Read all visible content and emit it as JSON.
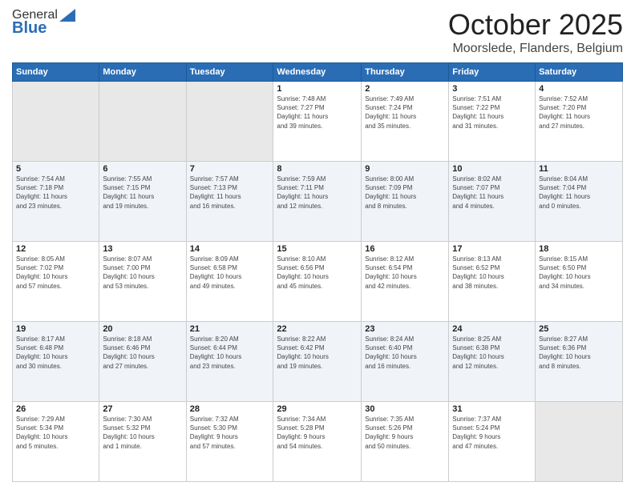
{
  "header": {
    "logo_general": "General",
    "logo_blue": "Blue",
    "month": "October 2025",
    "location": "Moorslede, Flanders, Belgium"
  },
  "weekdays": [
    "Sunday",
    "Monday",
    "Tuesday",
    "Wednesday",
    "Thursday",
    "Friday",
    "Saturday"
  ],
  "weeks": [
    [
      {
        "day": "",
        "info": ""
      },
      {
        "day": "",
        "info": ""
      },
      {
        "day": "",
        "info": ""
      },
      {
        "day": "1",
        "info": "Sunrise: 7:48 AM\nSunset: 7:27 PM\nDaylight: 11 hours\nand 39 minutes."
      },
      {
        "day": "2",
        "info": "Sunrise: 7:49 AM\nSunset: 7:24 PM\nDaylight: 11 hours\nand 35 minutes."
      },
      {
        "day": "3",
        "info": "Sunrise: 7:51 AM\nSunset: 7:22 PM\nDaylight: 11 hours\nand 31 minutes."
      },
      {
        "day": "4",
        "info": "Sunrise: 7:52 AM\nSunset: 7:20 PM\nDaylight: 11 hours\nand 27 minutes."
      }
    ],
    [
      {
        "day": "5",
        "info": "Sunrise: 7:54 AM\nSunset: 7:18 PM\nDaylight: 11 hours\nand 23 minutes."
      },
      {
        "day": "6",
        "info": "Sunrise: 7:55 AM\nSunset: 7:15 PM\nDaylight: 11 hours\nand 19 minutes."
      },
      {
        "day": "7",
        "info": "Sunrise: 7:57 AM\nSunset: 7:13 PM\nDaylight: 11 hours\nand 16 minutes."
      },
      {
        "day": "8",
        "info": "Sunrise: 7:59 AM\nSunset: 7:11 PM\nDaylight: 11 hours\nand 12 minutes."
      },
      {
        "day": "9",
        "info": "Sunrise: 8:00 AM\nSunset: 7:09 PM\nDaylight: 11 hours\nand 8 minutes."
      },
      {
        "day": "10",
        "info": "Sunrise: 8:02 AM\nSunset: 7:07 PM\nDaylight: 11 hours\nand 4 minutes."
      },
      {
        "day": "11",
        "info": "Sunrise: 8:04 AM\nSunset: 7:04 PM\nDaylight: 11 hours\nand 0 minutes."
      }
    ],
    [
      {
        "day": "12",
        "info": "Sunrise: 8:05 AM\nSunset: 7:02 PM\nDaylight: 10 hours\nand 57 minutes."
      },
      {
        "day": "13",
        "info": "Sunrise: 8:07 AM\nSunset: 7:00 PM\nDaylight: 10 hours\nand 53 minutes."
      },
      {
        "day": "14",
        "info": "Sunrise: 8:09 AM\nSunset: 6:58 PM\nDaylight: 10 hours\nand 49 minutes."
      },
      {
        "day": "15",
        "info": "Sunrise: 8:10 AM\nSunset: 6:56 PM\nDaylight: 10 hours\nand 45 minutes."
      },
      {
        "day": "16",
        "info": "Sunrise: 8:12 AM\nSunset: 6:54 PM\nDaylight: 10 hours\nand 42 minutes."
      },
      {
        "day": "17",
        "info": "Sunrise: 8:13 AM\nSunset: 6:52 PM\nDaylight: 10 hours\nand 38 minutes."
      },
      {
        "day": "18",
        "info": "Sunrise: 8:15 AM\nSunset: 6:50 PM\nDaylight: 10 hours\nand 34 minutes."
      }
    ],
    [
      {
        "day": "19",
        "info": "Sunrise: 8:17 AM\nSunset: 6:48 PM\nDaylight: 10 hours\nand 30 minutes."
      },
      {
        "day": "20",
        "info": "Sunrise: 8:18 AM\nSunset: 6:46 PM\nDaylight: 10 hours\nand 27 minutes."
      },
      {
        "day": "21",
        "info": "Sunrise: 8:20 AM\nSunset: 6:44 PM\nDaylight: 10 hours\nand 23 minutes."
      },
      {
        "day": "22",
        "info": "Sunrise: 8:22 AM\nSunset: 6:42 PM\nDaylight: 10 hours\nand 19 minutes."
      },
      {
        "day": "23",
        "info": "Sunrise: 8:24 AM\nSunset: 6:40 PM\nDaylight: 10 hours\nand 16 minutes."
      },
      {
        "day": "24",
        "info": "Sunrise: 8:25 AM\nSunset: 6:38 PM\nDaylight: 10 hours\nand 12 minutes."
      },
      {
        "day": "25",
        "info": "Sunrise: 8:27 AM\nSunset: 6:36 PM\nDaylight: 10 hours\nand 8 minutes."
      }
    ],
    [
      {
        "day": "26",
        "info": "Sunrise: 7:29 AM\nSunset: 5:34 PM\nDaylight: 10 hours\nand 5 minutes."
      },
      {
        "day": "27",
        "info": "Sunrise: 7:30 AM\nSunset: 5:32 PM\nDaylight: 10 hours\nand 1 minute."
      },
      {
        "day": "28",
        "info": "Sunrise: 7:32 AM\nSunset: 5:30 PM\nDaylight: 9 hours\nand 57 minutes."
      },
      {
        "day": "29",
        "info": "Sunrise: 7:34 AM\nSunset: 5:28 PM\nDaylight: 9 hours\nand 54 minutes."
      },
      {
        "day": "30",
        "info": "Sunrise: 7:35 AM\nSunset: 5:26 PM\nDaylight: 9 hours\nand 50 minutes."
      },
      {
        "day": "31",
        "info": "Sunrise: 7:37 AM\nSunset: 5:24 PM\nDaylight: 9 hours\nand 47 minutes."
      },
      {
        "day": "",
        "info": ""
      }
    ]
  ]
}
